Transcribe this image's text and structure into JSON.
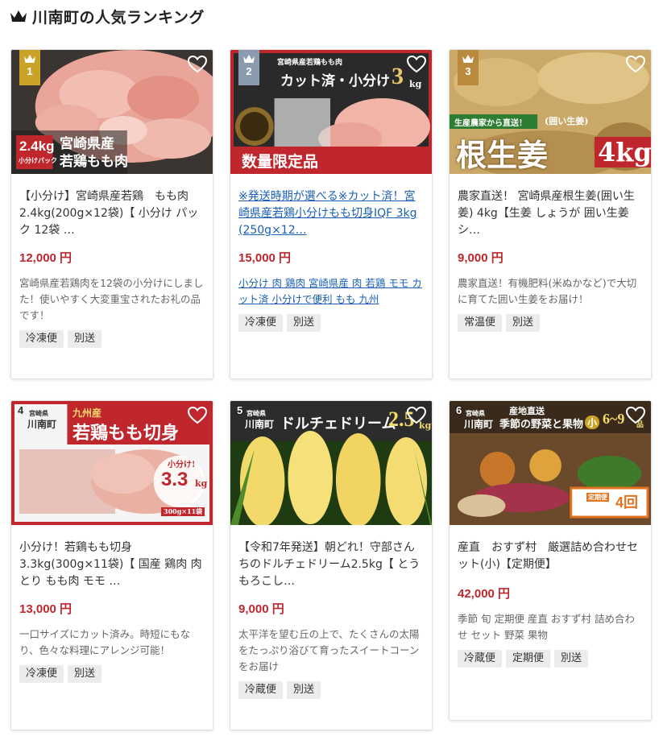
{
  "header": {
    "title": "川南町の人気ランキング",
    "icon": "crown-icon"
  },
  "colors": {
    "price": "#c0272d",
    "link": "#1a5fb4",
    "gold": "#c9a227",
    "silver": "#8a9bb0",
    "bronze": "#b98a3e"
  },
  "products": [
    {
      "rank": "1",
      "name": "【小分け】宮崎県産若鶏　もも肉2.4kg(200g×12袋)【 小分け パック 12袋 …",
      "price": "12,000 円",
      "desc": "宮崎県産若鶏肉を12袋の小分けにしました！使いやすく大変重宝されたお礼の品です！",
      "tags": [
        "冷凍便",
        "別送"
      ],
      "img_text": [
        "宮崎県産",
        "若鶏もも肉",
        "2.4kg",
        "小分けパック"
      ]
    },
    {
      "rank": "2",
      "name": "※発送時期が選べる※カット済！宮崎県産若鶏小分けもも切身IQF 3kg (250g×12…",
      "price": "15,000 円",
      "desc": "小分け 肉 鶏肉 宮崎県産 肉 若鶏 モモ カット済 小分けで便利 もも 九州",
      "tags": [
        "冷凍便",
        "別送"
      ],
      "img_text": [
        "宮崎県産若鶏もも肉",
        "カット済・小分け",
        "3",
        "kg",
        "数量限定品"
      ]
    },
    {
      "rank": "3",
      "name": "農家直送！ 宮崎県産根生姜(囲い生姜) 4kg【生姜 しょうが 囲い生姜 シ…",
      "price": "9,000 円",
      "desc": "農家直送！有機肥料(米ぬかなど)で大切に育てた囲い生姜をお届け！",
      "tags": [
        "常温便",
        "別送"
      ],
      "img_text": [
        "生産農家から直送！",
        "(囲い生姜)",
        "根生姜",
        "4kg"
      ]
    },
    {
      "rank": "4",
      "name": "小分け！若鶏もも切身 3.3kg(300g×11袋)【 国産 鶏肉 肉 とり もも肉 モモ …",
      "price": "13,000 円",
      "desc": "一口サイズにカット済み。時短にもなり、色々な料理にアレンジ可能！",
      "tags": [
        "冷凍便",
        "別送"
      ],
      "img_text": [
        "九州産",
        "若鶏もも切身",
        "小分け!",
        "3.3",
        "kg",
        "300g×11袋",
        "宮崎県",
        "川南町"
      ]
    },
    {
      "rank": "5",
      "name": "【令和7年発送】朝どれ！守部さんちのドルチェドリーム2.5kg【 とうもろこし…",
      "price": "9,000 円",
      "desc": "太平洋を望む丘の上で、たくさんの太陽をたっぷり浴びて育ったスイートコーンをお届け",
      "tags": [
        "冷蔵便",
        "別送"
      ],
      "img_text": [
        "宮崎県",
        "川南町",
        "ドルチェドリーム",
        "2.5",
        "kg"
      ]
    },
    {
      "rank": "6",
      "name": "産直　おすず村　厳選詰め合わせセット(小)【定期便】",
      "price": "42,000 円",
      "desc": "季節 旬 定期便 産直 おすず村 詰め合わせ セット 野菜 果物",
      "tags": [
        "冷蔵便",
        "定期便",
        "別送"
      ],
      "img_text": [
        "産地直送",
        "季節の野菜と果物",
        "小",
        "6~9",
        "品",
        "定期便",
        "4回",
        "宮崎県",
        "川南町"
      ]
    }
  ]
}
